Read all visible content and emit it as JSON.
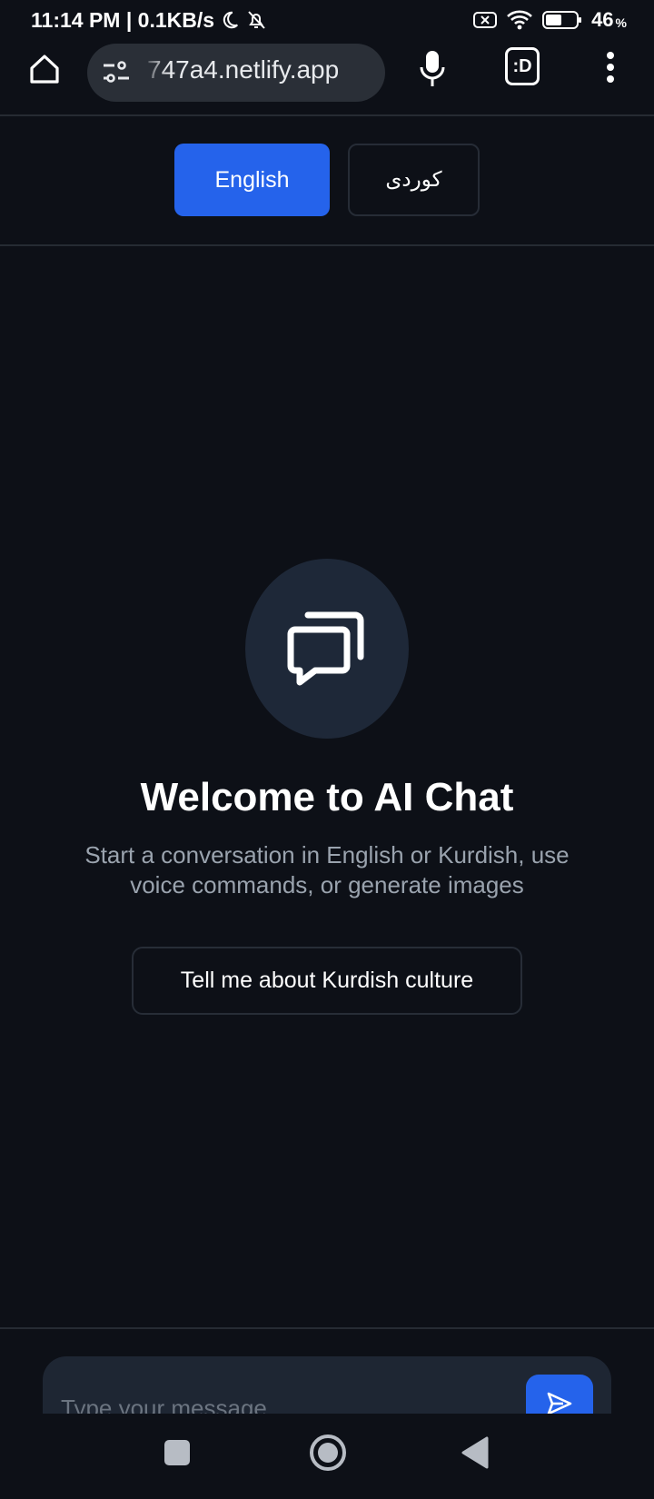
{
  "status_bar": {
    "time_speed": "11:14 PM | 0.1KB/s",
    "battery_percent": "46",
    "battery_unit": "%"
  },
  "browser": {
    "url": "747a4.netlify.app",
    "tab_icon_label": ":D"
  },
  "language_switch": {
    "english_label": "English",
    "kurdish_label": "کوردی",
    "selected": "English"
  },
  "welcome": {
    "title": "Welcome to AI Chat",
    "subtitle": "Start a conversation in English or Kurdish, use voice commands, or generate images"
  },
  "suggestions": [
    {
      "label": "Tell me about Kurdish culture"
    }
  ],
  "composer": {
    "placeholder": "Type your message..."
  },
  "colors": {
    "accent": "#2563eb",
    "background": "#0d1017",
    "surface": "#1e2633"
  }
}
